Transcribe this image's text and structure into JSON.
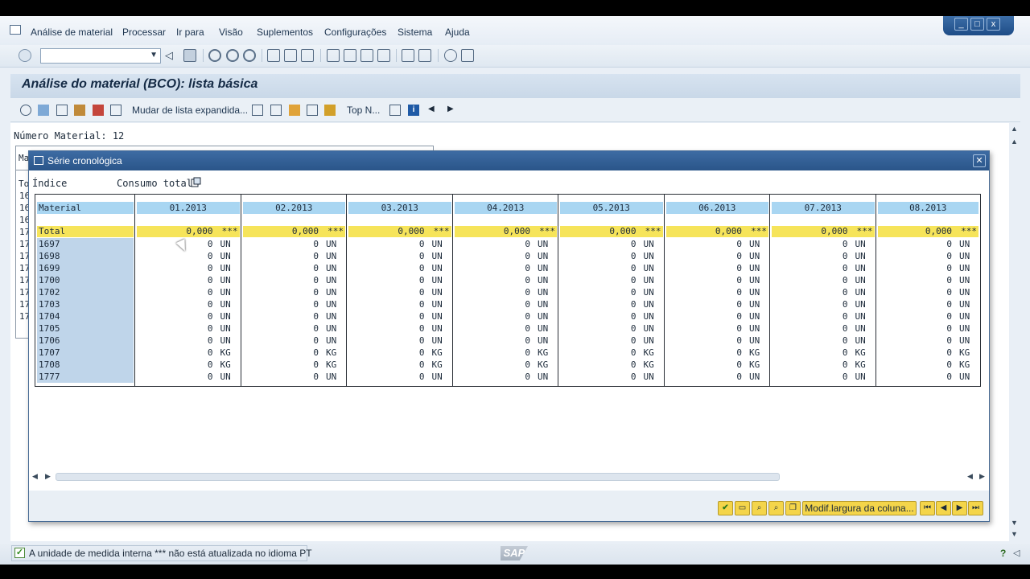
{
  "menubar": {
    "items": [
      "Análise de material",
      "Processar",
      "Ir para",
      "Visão",
      "Suplementos",
      "Configurações",
      "Sistema",
      "Ajuda"
    ]
  },
  "window_controls": [
    "_",
    "□",
    "x"
  ],
  "title": "Análise do material (BCO): lista básica",
  "apptoolbar": {
    "expanded_list_label": "Mudar de lista expandida...",
    "top_n_label": "Top N..."
  },
  "content": {
    "material_number_label": "Número Material: 12"
  },
  "dialog": {
    "title": "Série cronológica",
    "indice_label": "Índice",
    "consumo_label": "Consumo total",
    "material_header": "Material",
    "periods": [
      "01.2013",
      "02.2013",
      "03.2013",
      "04.2013",
      "05.2013",
      "06.2013",
      "07.2013",
      "08.2013"
    ],
    "total_label": "Total",
    "total_value": "0,000",
    "total_unit": "***",
    "rows": [
      {
        "material": "1697",
        "value": "0",
        "unit": "UN"
      },
      {
        "material": "1698",
        "value": "0",
        "unit": "UN"
      },
      {
        "material": "1699",
        "value": "0",
        "unit": "UN"
      },
      {
        "material": "1700",
        "value": "0",
        "unit": "UN"
      },
      {
        "material": "1702",
        "value": "0",
        "unit": "UN"
      },
      {
        "material": "1703",
        "value": "0",
        "unit": "UN"
      },
      {
        "material": "1704",
        "value": "0",
        "unit": "UN"
      },
      {
        "material": "1705",
        "value": "0",
        "unit": "UN"
      },
      {
        "material": "1706",
        "value": "0",
        "unit": "UN"
      },
      {
        "material": "1707",
        "value": "0",
        "unit": "KG"
      },
      {
        "material": "1708",
        "value": "0",
        "unit": "KG"
      },
      {
        "material": "1777",
        "value": "0",
        "unit": "UN"
      }
    ],
    "modif_button": "Modif.largura da coluna..."
  },
  "background_rows": [
    "16",
    "16",
    "16",
    "17",
    "17",
    "17",
    "17",
    "17",
    "17",
    "17",
    "17"
  ],
  "background_headers": [
    "Ma",
    "To"
  ],
  "status": {
    "message": "A unidade de medida interna *** não está atualizada no idioma PT",
    "sap_logo": "SAP"
  },
  "colors": {
    "header_bg": "#a9d6f2",
    "total_bg": "#f6e45a",
    "material_bg": "#bfd5ea",
    "dialog_title_bg": "#2a5589"
  }
}
